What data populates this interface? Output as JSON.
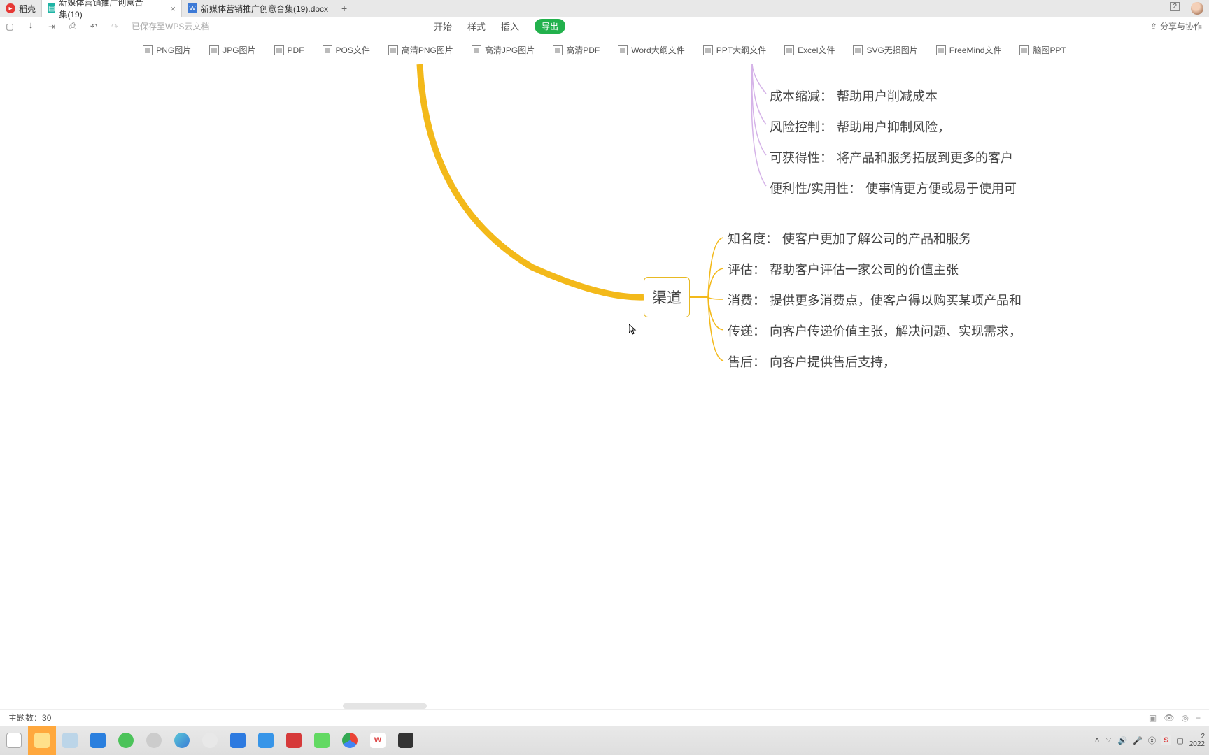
{
  "tabs": {
    "t0": "稻壳",
    "t1": "新媒体营销推广创意合集(19)",
    "t2": "新媒体营销推广创意合集(19).docx"
  },
  "badge": "2",
  "toolbar": {
    "saved": "已保存至WPS云文档"
  },
  "menu": {
    "start": "开始",
    "style": "样式",
    "insert": "插入",
    "export": "导出"
  },
  "share": "分享与协作",
  "formats": {
    "png": "PNG图片",
    "jpg": "JPG图片",
    "pdf": "PDF",
    "pos": "POS文件",
    "hdpng": "高清PNG图片",
    "hdjpg": "高清JPG图片",
    "hdpdf": "高清PDF",
    "word": "Word大纲文件",
    "ppt": "PPT大纲文件",
    "excel": "Excel文件",
    "svg": "SVG无损图片",
    "freemind": "FreeMind文件",
    "mindppt": "脑图PPT"
  },
  "mindmap": {
    "channel": "渠道",
    "group1": {
      "n1": {
        "lbl": "成本缩减：",
        "txt": "帮助用户削减成本"
      },
      "n2": {
        "lbl": "风险控制：",
        "txt": "帮助用户抑制风险，"
      },
      "n3": {
        "lbl": "可获得性：",
        "txt": "将产品和服务拓展到更多的客户"
      },
      "n4": {
        "lbl": "便利性/实用性：",
        "txt": "使事情更方便或易于使用可"
      }
    },
    "group2": {
      "n1": {
        "lbl": "知名度：",
        "txt": "使客户更加了解公司的产品和服务"
      },
      "n2": {
        "lbl": "评估：",
        "txt": "帮助客户评估一家公司的价值主张"
      },
      "n3": {
        "lbl": "消费：",
        "txt": "提供更多消费点，使客户得以购买某项产品和"
      },
      "n4": {
        "lbl": "传递：",
        "txt": "向客户传递价值主张，解决问题、实现需求，"
      },
      "n5": {
        "lbl": "售后：",
        "txt": "向客户提供售后支持，"
      }
    }
  },
  "status": {
    "topics_label": "主题数：",
    "topics_count": "30"
  },
  "tray": {
    "time1": "2",
    "time2": "2022"
  }
}
